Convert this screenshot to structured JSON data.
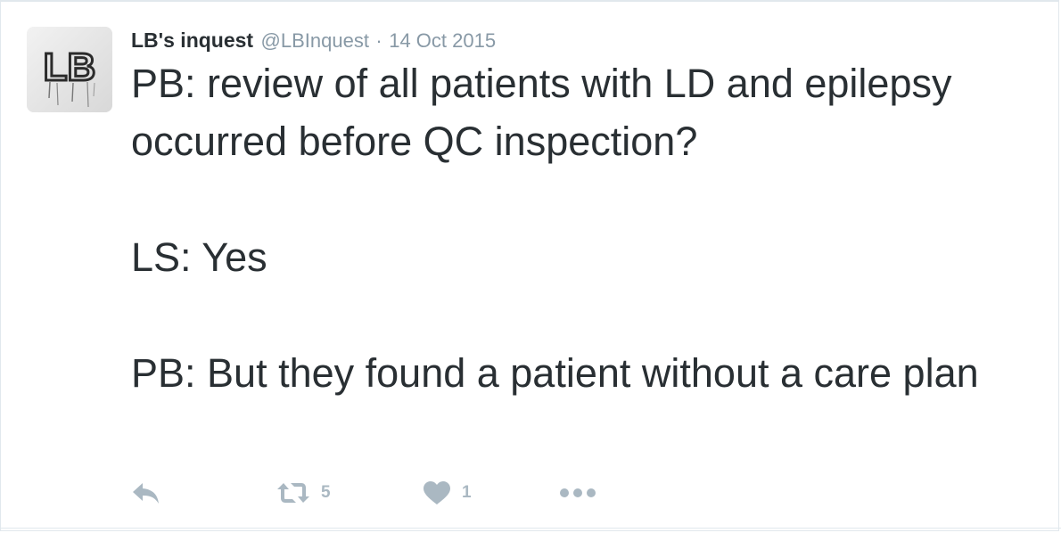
{
  "tweet": {
    "author": {
      "display_name": "LB's inquest",
      "handle": "@LBInquest",
      "avatar_text": "LB"
    },
    "separator": "·",
    "date": "14 Oct 2015",
    "paragraphs": [
      "PB: review of all patients with LD and epilepsy occurred before QC inspection?",
      "LS: Yes",
      "PB: But they found a patient without a care plan"
    ],
    "actions": {
      "reply_icon": "reply-icon",
      "retweet_icon": "retweet-icon",
      "retweet_count": "5",
      "like_icon": "heart-icon",
      "like_count": "1",
      "more_icon": "more-icon"
    }
  },
  "colors": {
    "text": "#292f33",
    "muted": "#8899a6",
    "action": "#aab8c2",
    "border": "#e1e8ed"
  }
}
